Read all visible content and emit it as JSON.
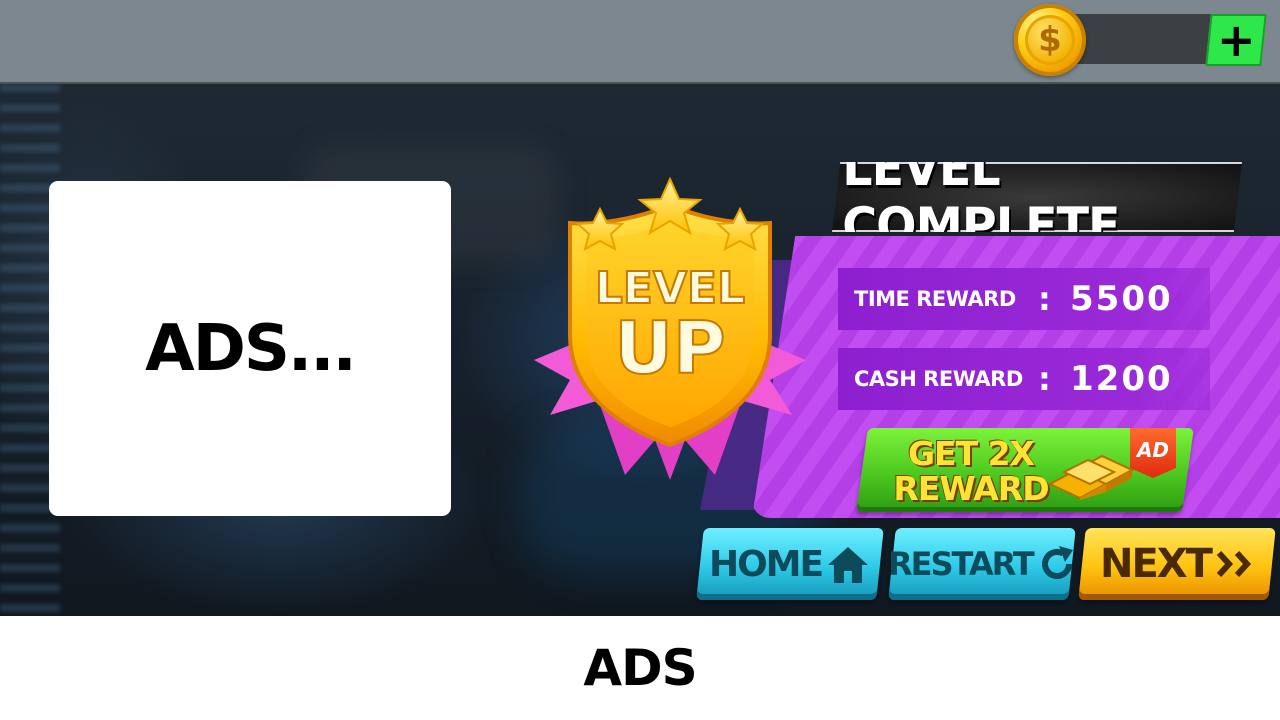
{
  "currency": {
    "coin_symbol": "$",
    "amount": "",
    "add_label": "+"
  },
  "ad_box": {
    "label": "ADS..."
  },
  "badge": {
    "line1": "LEVEL",
    "line2": "UP"
  },
  "level_complete": {
    "title": "LEVEL COMPLETE",
    "rewards": [
      {
        "label": "TIME REWARD",
        "separator": ":",
        "value": "5500"
      },
      {
        "label": "CASH REWARD",
        "separator": ":",
        "value": "1200"
      }
    ],
    "double_reward": {
      "line1": "GET 2X",
      "line2": "REWARD",
      "tag": "AD"
    }
  },
  "buttons": {
    "home": "HOME",
    "restart": "RESTART",
    "next": "NEXT"
  },
  "bottom_banner": {
    "label": "ADS"
  },
  "colors": {
    "panel": "#c24df0",
    "reward_row": "#9a2ad8",
    "home_button": "#2ec9e8",
    "next_button": "#ffc20f",
    "reward_button": "#4cc81f",
    "plus_button": "#2ee84a"
  }
}
